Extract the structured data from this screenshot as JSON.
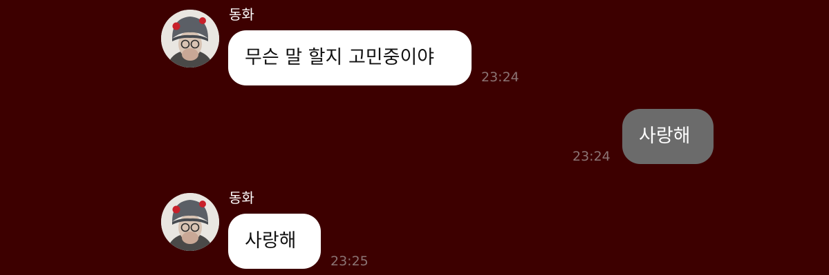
{
  "chat": {
    "messages": [
      {
        "direction": "incoming",
        "sender": "동화",
        "avatar": "profile-photo",
        "text": "무슨 말 할지 고민중이야",
        "time": "23:24"
      },
      {
        "direction": "outgoing",
        "text": "사랑해",
        "time": "23:24"
      },
      {
        "direction": "incoming",
        "sender": "동화",
        "avatar": "profile-photo",
        "text": "사랑해",
        "time": "23:25"
      }
    ]
  },
  "colors": {
    "background": "#3d0000",
    "incoming_bubble": "#ffffff",
    "outgoing_bubble": "#6b6b6b",
    "timestamp": "#8b7474",
    "name": "#ffffff"
  }
}
